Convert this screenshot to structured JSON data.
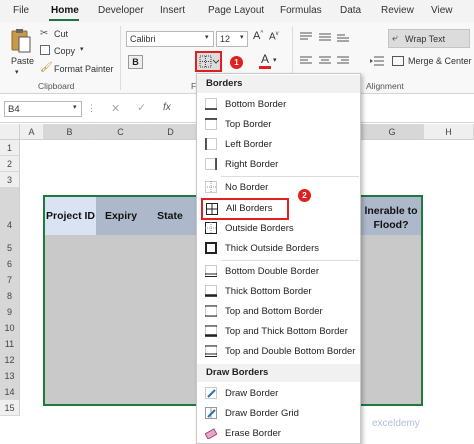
{
  "menu": {
    "tabs": [
      "File",
      "Home",
      "Developer",
      "Insert",
      "Page Layout",
      "Formulas",
      "Data",
      "Review",
      "View"
    ]
  },
  "ribbon": {
    "cut_label": "Cut",
    "copy_label": "Copy",
    "paste_label": "Paste",
    "format_painter_label": "Format Painter",
    "clipboard_group": "Clipboard",
    "font_name": "Calibri",
    "font_size": "12",
    "font_group_initial": "F",
    "bold": "B",
    "wrap_text_label": "Wrap Text",
    "merge_center_label": "Merge & Center",
    "alignment_group": "Alignment"
  },
  "formula_bar": {
    "name_box": "B4",
    "fx": "fx"
  },
  "columns": [
    "A",
    "B",
    "C",
    "D",
    "G",
    "H"
  ],
  "rows": [
    "1",
    "2",
    "3",
    "4",
    "5",
    "6",
    "7",
    "8",
    "9",
    "10",
    "11",
    "12",
    "13",
    "14",
    "15"
  ],
  "table": {
    "headers": [
      "Project ID",
      "Expiry",
      "State"
    ],
    "last_header_line1": "lnerable to",
    "last_header_line2": "Flood?"
  },
  "dropdown": {
    "section1": "Borders",
    "items1": [
      "Bottom Border",
      "Top Border",
      "Left Border",
      "Right Border"
    ],
    "items2": [
      "No Border",
      "All Borders",
      "Outside Borders",
      "Thick Outside Borders"
    ],
    "items3": [
      "Bottom Double Border",
      "Thick Bottom Border",
      "Top and Bottom Border",
      "Top and Thick Bottom Border",
      "Top and Double Bottom Border"
    ],
    "section2": "Draw Borders",
    "items4": [
      "Draw Border",
      "Draw Border Grid",
      "Erase Border"
    ]
  },
  "badges": {
    "one": "1",
    "two": "2"
  },
  "watermark": "exceldemy",
  "colors": {
    "accent_green": "#217346",
    "highlight_red": "#e02020",
    "header_blue": "#dae3f3",
    "header_gray": "#c9c9c9",
    "table_border": "#1e7a3e"
  }
}
